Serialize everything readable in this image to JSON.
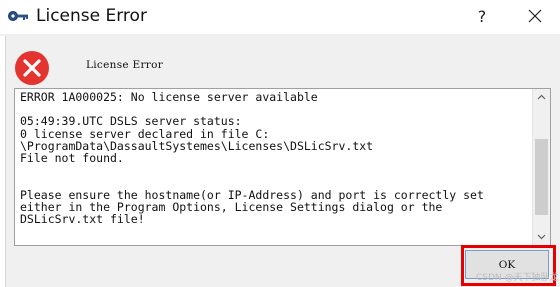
{
  "window": {
    "title": "License Error",
    "help_label": "?",
    "icon": "key-icon"
  },
  "header": {
    "icon": "error-icon",
    "text": "License Error"
  },
  "message": {
    "lines": [
      "ERROR 1A000025: No license server available",
      "",
      "05:49:39.UTC DSLS server status:",
      "0 license server declared in file C:",
      "\\ProgramData\\DassaultSystemes\\Licenses\\DSLicSrv.txt",
      "File not found.",
      "",
      "",
      "Please ensure the hostname(or IP-Address) and port is correctly set",
      "either in the Program Options, License Settings dialog or the",
      "DSLicSrv.txt file!"
    ]
  },
  "buttons": {
    "ok_label": "OK"
  },
  "watermark": "CSDN @天下独卧龙",
  "colors": {
    "error_red": "#e3342f",
    "highlight_red": "#e60000",
    "focus_border": "#7a9cc7"
  }
}
